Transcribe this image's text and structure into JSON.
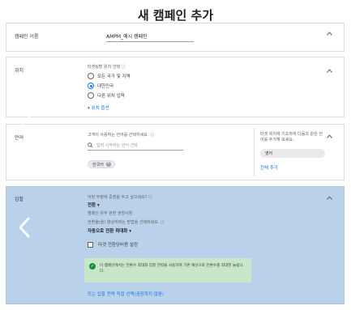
{
  "page": {
    "title": "새 캠페인 추가"
  },
  "campaign_name": {
    "label": "캠페인 이름",
    "value": "AMPM_예시 캠페인"
  },
  "location": {
    "label": "위치",
    "hint": "타겟팅할 위치 선택 ⓘ",
    "options": [
      {
        "label": "모든 국가 및 지역",
        "selected": false
      },
      {
        "label": "대한민국",
        "selected": true
      },
      {
        "label": "다른 위치 입력",
        "selected": false
      }
    ],
    "more_link": "위치 옵션"
  },
  "language": {
    "label": "언어",
    "hint": "고객이 사용하는 언어를 선택하세요. ⓘ",
    "search_placeholder": "입력 시작하는 언어 선택",
    "chip": "한국어",
    "side_note": "타겟 위치에 기초하여 다음과 같은 언어를 추가해 보세요.",
    "side_chip": "영어",
    "add_all": "전체 추가"
  },
  "bidding": {
    "label": "입찰",
    "focus_prompt": "어떤 부분에 중점을 두고 싶으세요? ⓘ",
    "focus_value": "전환 ▾",
    "focus_note": "캠페인 유무 관련 권장사항",
    "method_prompt": "전환율(을) 향상하려는 방법을 선택하세요. ⓘ",
    "method_value": "자동으로 전환 최대화 ▾",
    "target_cpa_label": "타겟 전환당비용 설정",
    "notice": "이 캠페인에서는 전환수 최대화 입찰 전략을 사용하여 기존 예산으로 전환수를 최대한 늘립니다.",
    "alt_link": "또는 입찰 전략 직접 선택(권장하지 않음)"
  },
  "colors": {
    "accent": "#1a73e8",
    "highlight": "#b9d2ea",
    "notice_bg": "#c8e6c9",
    "success": "#1e8e3e"
  },
  "icons": [
    "chevron-up-icon",
    "search-icon",
    "close-icon",
    "check-circle-icon",
    "chevron-down-icon",
    "arrow-right-icon",
    "reload-icon",
    "arrow-left-icon"
  ]
}
